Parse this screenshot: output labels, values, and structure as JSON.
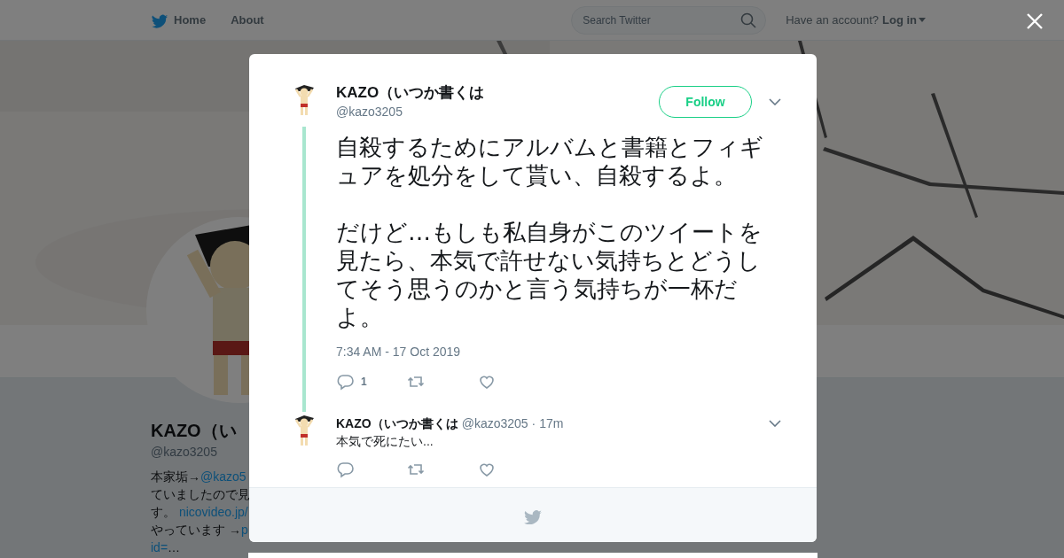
{
  "nav": {
    "links": [
      {
        "label": "Home",
        "kind": "home"
      },
      {
        "label": "About",
        "kind": "plain"
      }
    ],
    "search": {
      "placeholder": "Search Twitter"
    },
    "account_prompt": "Have an account?",
    "login": "Log in"
  },
  "profile": {
    "name": "KAZO（い",
    "handle": "@kazo3205",
    "bio_lines": [
      [
        {
          "text": "本家垢→"
        },
        {
          "text": "@kazo5",
          "link": true
        }
      ],
      [
        {
          "text": "ていましたので見"
        }
      ],
      [
        {
          "text": "す。 "
        },
        {
          "text": "nicovideo.jp/",
          "link": true
        }
      ],
      [
        {
          "text": "やっています →"
        },
        {
          "text": "p",
          "link": true
        }
      ],
      [
        {
          "text": "id=",
          "link": true
        },
        {
          "text": "…"
        }
      ]
    ]
  },
  "modal": {
    "tweet": {
      "name": "KAZO（いつか書くは",
      "handle": "@kazo3205",
      "follow": "Follow",
      "paragraphs": [
        "自殺するためにアルバムと書籍とフィギュアを処分をして貰い、自殺するよ。",
        "だけど…もしも私自身がこのツイートを見たら、本気で許せない気持ちとどうしてそう思うのかと言う気持ちが一杯だよ。"
      ],
      "timestamp": "7:34 AM - 17 Oct 2019",
      "actions": [
        {
          "kind": "reply",
          "count": "1"
        },
        {
          "kind": "retweet"
        },
        {
          "kind": "like"
        }
      ]
    },
    "replies": [
      {
        "name": "KAZO（いつか書くは",
        "handle": "@kazo3205",
        "separator": "·",
        "time": "17m",
        "text": "本気で死にたい...",
        "actions": [
          {
            "kind": "reply"
          },
          {
            "kind": "retweet"
          },
          {
            "kind": "like"
          }
        ]
      }
    ]
  }
}
